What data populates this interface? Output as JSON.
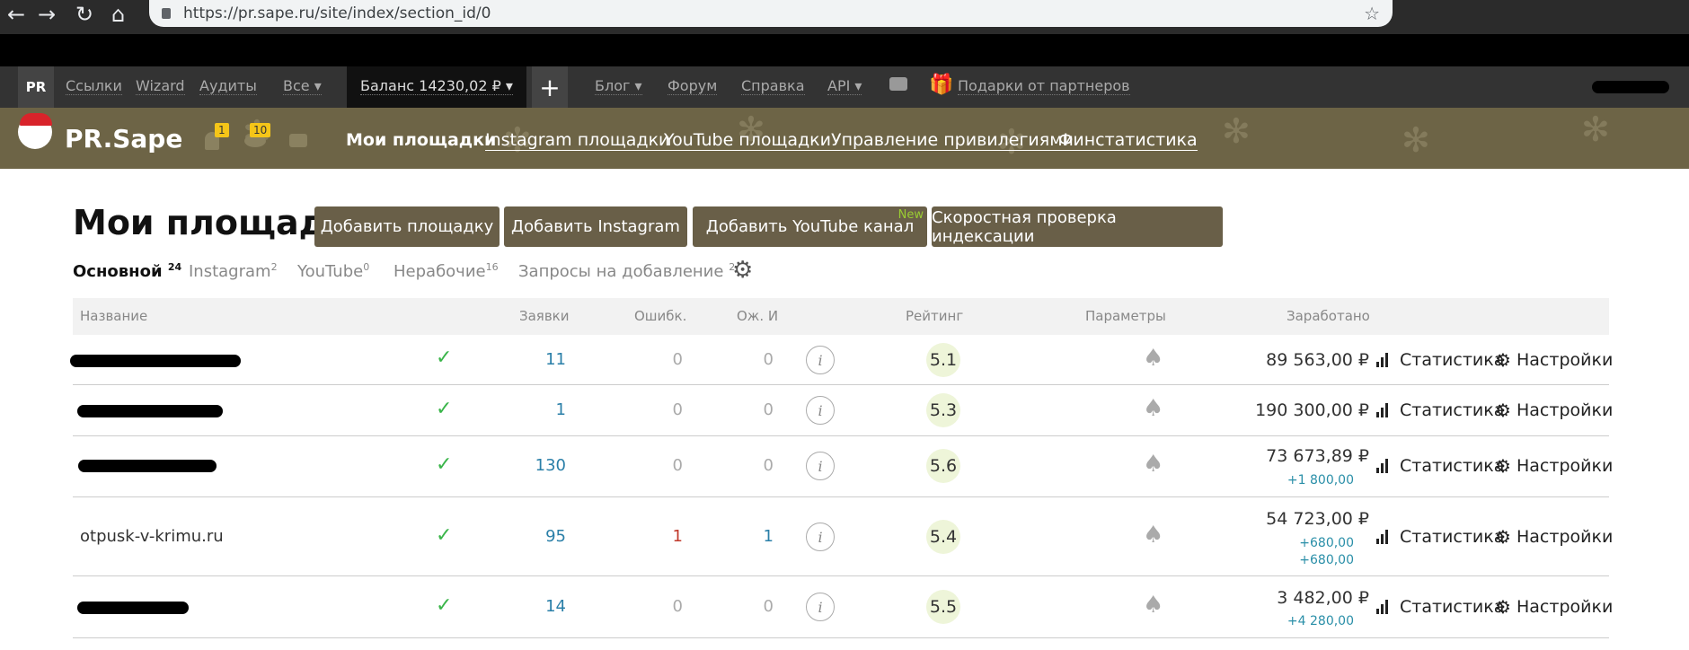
{
  "browser": {
    "url": "https://pr.sape.ru/site/index/section_id/0",
    "back_icon": "arrow-left-icon",
    "forward_icon": "arrow-right-icon",
    "reload_icon": "reload-icon",
    "home_icon": "home-icon",
    "star_icon": "star-icon"
  },
  "topbar": {
    "pr_label": "PR",
    "links": [
      "Ссылки",
      "Wizard",
      "Аудиты",
      "Все ▾"
    ],
    "balance": "Баланс 14230,02 ₽ ▾",
    "plus": "+",
    "right_links": [
      "Блог ▾",
      "Форум",
      "Справка",
      "API ▾"
    ],
    "gifts": "Подарки от партнеров"
  },
  "brand": {
    "name": "PR.Sape",
    "bell_count": "1",
    "eye_count": "10",
    "nav": [
      "Мои площадки",
      "Instagram площадки",
      "YouTube площадки",
      "Управление привилегиями",
      "Финстатистика"
    ]
  },
  "page": {
    "title": "Мои площадки",
    "buttons": [
      "Добавить площадку",
      "Добавить Instagram",
      "Добавить YouTube канал",
      "Скоростная проверка индексации"
    ],
    "new_badge": "New",
    "tabs": [
      {
        "label": "Основной",
        "count": "24"
      },
      {
        "label": "Instagram",
        "count": "2"
      },
      {
        "label": "YouTube",
        "count": "0"
      },
      {
        "label": "Нерабочие",
        "count": "16"
      },
      {
        "label": "Запросы на добавление",
        "count": "2"
      }
    ]
  },
  "table": {
    "headers": [
      "Название",
      "Заявки",
      "Ошибк.",
      "Ож. И",
      "Рейтинг",
      "Параметры",
      "Заработано"
    ],
    "stat_label": "Статистика",
    "settings_label": "Настройки",
    "info_glyph": "i",
    "rows": [
      {
        "name": "",
        "requests": "11",
        "errors": "0",
        "waiting": "0",
        "rating": "5.1",
        "earned": "89 563,00 ₽",
        "delta": []
      },
      {
        "name": "",
        "requests": "1",
        "errors": "0",
        "waiting": "0",
        "rating": "5.3",
        "earned": "190 300,00 ₽",
        "delta": []
      },
      {
        "name": "",
        "requests": "130",
        "errors": "0",
        "waiting": "0",
        "rating": "5.6",
        "earned": "73 673,89 ₽",
        "delta": [
          "+1 800,00"
        ]
      },
      {
        "name": "otpusk-v-krimu.ru",
        "requests": "95",
        "errors": "1",
        "waiting": "1",
        "rating": "5.4",
        "earned": "54 723,00 ₽",
        "delta": [
          "+680,00",
          "+680,00"
        ]
      },
      {
        "name": "",
        "requests": "14",
        "errors": "0",
        "waiting": "0",
        "rating": "5.5",
        "earned": "3 482,00 ₽",
        "delta": [
          "+4 280,00"
        ]
      }
    ]
  },
  "colors": {
    "brand_bar": "#6d6446",
    "button": "#695f48",
    "accent_blue": "#2a7fa8",
    "check_green": "#3ab54a",
    "new_badge": "#9acd32"
  }
}
